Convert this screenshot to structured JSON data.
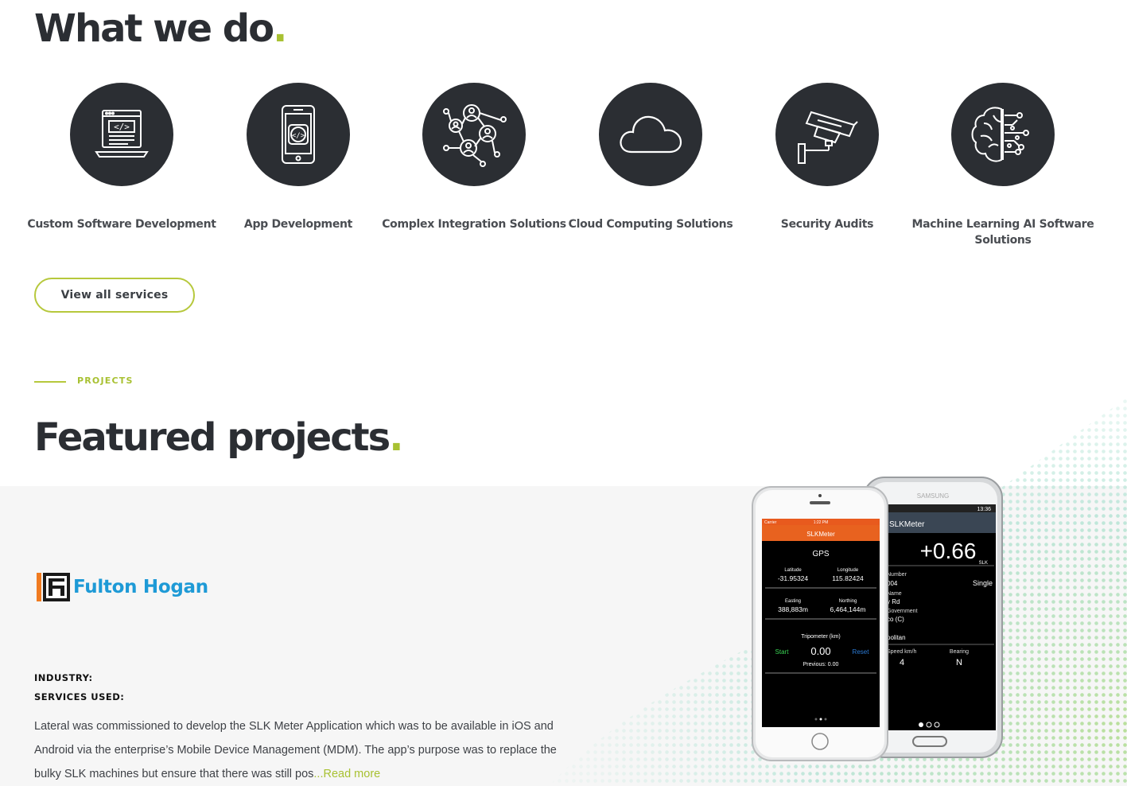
{
  "header": {
    "title": "What we do",
    "title_dot": "."
  },
  "services": [
    {
      "label": "Custom Software Development",
      "icon": "software-development-icon"
    },
    {
      "label": "App Development",
      "icon": "mobile-app-icon"
    },
    {
      "label": "Complex Integration Solutions",
      "icon": "network-integration-icon"
    },
    {
      "label": "Cloud Computing Solutions",
      "icon": "cloud-icon"
    },
    {
      "label": "Security Audits",
      "icon": "security-camera-icon"
    },
    {
      "label": "Machine Learning AI Software Solutions",
      "icon": "ai-brain-icon"
    }
  ],
  "cta": {
    "view_all_label": "View all services"
  },
  "projects": {
    "eyebrow": "PROJECTS",
    "title": "Featured projects",
    "title_dot": ".",
    "project": {
      "client_logo_text": "Fulton Hogan",
      "industry_label": "INDUSTRY:",
      "services_label": "SERVICES USED:",
      "description": "Lateral was commissioned to develop the SLK Meter Application which was to be available in iOS and Android via the enterprise’s Mobile Device Management (MDM). The app’s purpose was to replace the bulky SLK machines but ensure that there was still pos",
      "read_more": "...Read more"
    }
  },
  "phone_iphone": {
    "status_left": "Carrier",
    "status_time": "1:22 PM",
    "app_title": "SLKMeter",
    "section": "GPS",
    "lat_label": "Latitude",
    "lat_value": "-31.95324",
    "lon_label": "Longitude",
    "lon_value": "115.82424",
    "east_label": "Easting",
    "east_value": "388,883m",
    "north_label": "Northing",
    "north_value": "6,464,144m",
    "trip_label": "Tripometer (km)",
    "start": "Start",
    "trip_value": "0.00",
    "reset": "Reset",
    "previous": "Previous: 0.00"
  },
  "phone_samsung": {
    "brand": "SAMSUNG",
    "status_time": "13:36",
    "app_title": "SLKMeter",
    "big_value": "+0.66",
    "big_unit": "SLK",
    "row1": "Number",
    "row2": "004",
    "single": "Single",
    "row3": "Name",
    "row4": "y Rd",
    "row5": "Government",
    "row6": "co (C)",
    "row7": "politan",
    "speed_label": "Speed km/h",
    "speed_value": "4",
    "bearing_label": "Bearing",
    "bearing_value": "N"
  },
  "colors": {
    "accent": "#a8c132",
    "dark": "#2b2e33",
    "band": "#f6f6f6",
    "logo_blue": "#1e9ad6",
    "logo_orange": "#f07b20"
  }
}
